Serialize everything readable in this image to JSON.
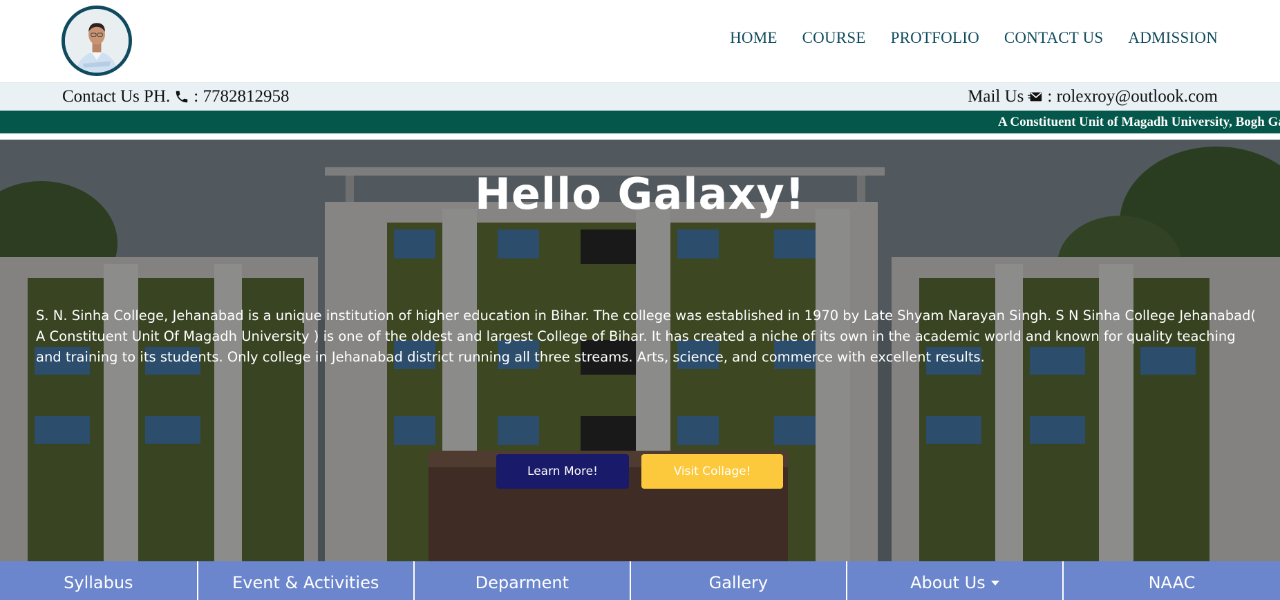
{
  "header": {
    "nav": [
      {
        "label": "HOME"
      },
      {
        "label": "COURSE"
      },
      {
        "label": "PROTFOLIO"
      },
      {
        "label": "CONTACT US"
      },
      {
        "label": "ADMISSION"
      }
    ]
  },
  "contact": {
    "phone_prefix": "Contact Us PH.",
    "phone_value": ": 7782812958",
    "mail_prefix": "Mail Us",
    "mail_value": ": rolexroy@outlook.com"
  },
  "marquee": {
    "text": "A Constituent Unit of Magadh University, Bogh Ga"
  },
  "hero": {
    "title": "Hello Galaxy!",
    "description": "S. N. Sinha College, Jehanabad is a unique institution of higher education in Bihar. The college was established in 1970 by Late Shyam Narayan Singh. S N Sinha College Jehanabad( A Constituent Unit Of Magadh University ) is one of the oldest and largest College of Bihar. It has created a niche of its own in the academic world and known for quality teaching and training to its students. Only college in Jehanabad district running all three streams. Arts, science, and commerce with excellent results.",
    "learn_more_label": "Learn More!",
    "visit_label": "Visit Collage!"
  },
  "bottom_nav": [
    {
      "label": "Syllabus"
    },
    {
      "label": "Event & Activities"
    },
    {
      "label": "Deparment"
    },
    {
      "label": "Gallery"
    },
    {
      "label": "About Us"
    },
    {
      "label": "NAAC"
    }
  ],
  "colors": {
    "nav_text": "#0f4a5e",
    "contact_bg": "#e9f1f5",
    "marquee_bg": "#04574a",
    "learn_btn": "#1a1a6b",
    "visit_btn": "#fcc93d",
    "bottom_nav_bg": "#6b86cc"
  },
  "icons": {
    "avatar": "profile-photo",
    "phone": "phone-icon",
    "mail": "mail-icon",
    "dropdown": "caret-down-icon"
  }
}
